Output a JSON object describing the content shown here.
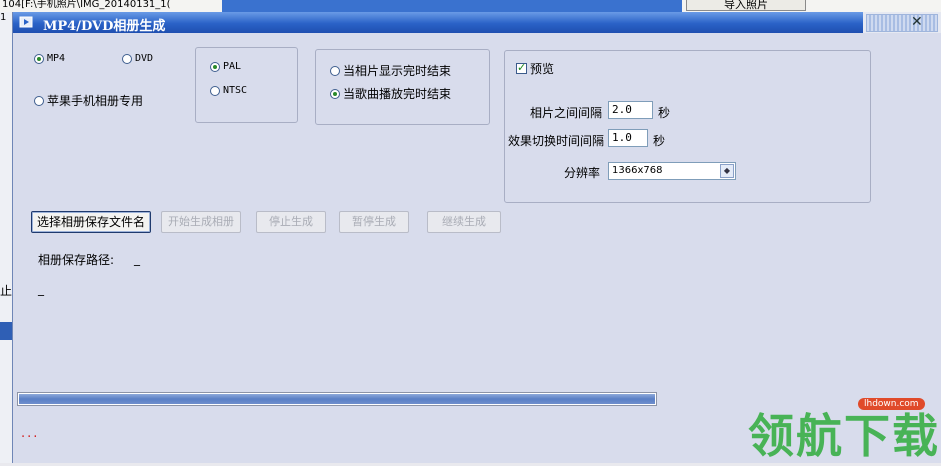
{
  "background": {
    "path_text": "104[F:\\手机照片\\IMG_20140131_1(",
    "import_button": "导入照片",
    "left_fragment": "止",
    "left_num": "1"
  },
  "dialog": {
    "title": "MP4/DVD相册生成",
    "format": {
      "mp4": "MP4",
      "dvd": "DVD",
      "apple": "苹果手机相册专用",
      "selected": "mp4"
    },
    "video_standard": {
      "pal": "PAL",
      "ntsc": "NTSC",
      "selected": "pal"
    },
    "end_mode": {
      "photos_done": "当相片显示完时结束",
      "music_done": "当歌曲播放完时结束",
      "selected": "music_done"
    },
    "settings": {
      "preview_label": "预览",
      "preview_checked": true,
      "photo_interval_label": "相片之间间隔",
      "photo_interval_value": "2.0",
      "photo_interval_unit": "秒",
      "transition_label": "效果切换时间间隔",
      "transition_value": "1.0",
      "transition_unit": "秒",
      "resolution_label": "分辨率",
      "resolution_value": "1366x768"
    },
    "buttons": {
      "choose_file": "选择相册保存文件名",
      "start": "开始生成相册",
      "stop": "停止生成",
      "pause": "暂停生成",
      "resume": "继续生成"
    },
    "save_path_label": "相册保存路径:",
    "save_path_value": "_",
    "second_line": "_",
    "progress": 1.0,
    "status_text": "..."
  },
  "watermark": {
    "text": "领航下载",
    "url": "lhdown.com"
  }
}
